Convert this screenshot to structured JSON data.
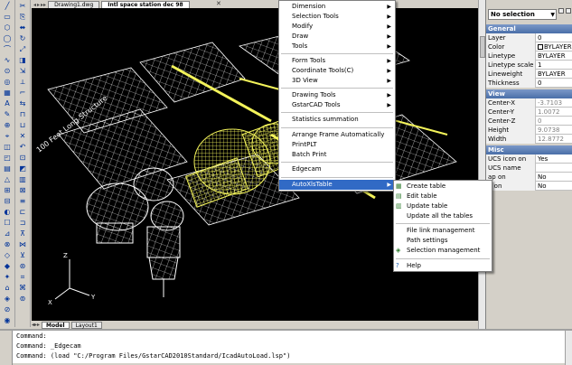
{
  "tabs": {
    "documents": [
      "Drawing1.dwg",
      "Intl space station dec 98"
    ],
    "active_index": 1,
    "layouts": [
      "Model",
      "Layout1"
    ],
    "active_layout": 0
  },
  "properties": {
    "selection": "No selection",
    "categories": {
      "general": "General",
      "view": "View",
      "misc": "Misc"
    },
    "general": [
      {
        "label": "Layer",
        "value": "0"
      },
      {
        "label": "Color",
        "value": "BYLAYER"
      },
      {
        "label": "Linetype",
        "value": "BYLAYER"
      },
      {
        "label": "Linetype scale",
        "value": "1"
      },
      {
        "label": "Lineweight",
        "value": "BYLAYER"
      },
      {
        "label": "Thickness",
        "value": "0"
      }
    ],
    "view": [
      {
        "label": "Center-X",
        "value": "-3.7103"
      },
      {
        "label": "Center-Y",
        "value": "1.0072"
      },
      {
        "label": "Center-Z",
        "value": "0"
      },
      {
        "label": "Height",
        "value": "9.0738"
      },
      {
        "label": "Width",
        "value": "12.8772"
      }
    ],
    "misc": [
      {
        "label": "UCS icon on",
        "value": "Yes"
      },
      {
        "label": "UCS name",
        "value": ""
      },
      {
        "label": "ap on",
        "value": "No"
      },
      {
        "label": "d on",
        "value": "No"
      }
    ]
  },
  "main_menu": {
    "items": [
      {
        "label": "Dimension",
        "submenu": true
      },
      {
        "label": "Selection Tools",
        "submenu": true
      },
      {
        "label": "Modify",
        "submenu": true
      },
      {
        "label": "Draw",
        "submenu": true
      },
      {
        "label": "Tools",
        "submenu": true
      },
      {
        "label": "Form Tools",
        "submenu": true
      },
      {
        "label": "Coordinate Tools(C)",
        "submenu": true
      },
      {
        "label": "3D View",
        "submenu": true
      },
      {
        "label": "Drawing Tools",
        "submenu": true
      },
      {
        "label": "GstarCAD Tools",
        "submenu": true
      },
      {
        "label": "Statistics summation",
        "submenu": false
      },
      {
        "label": "Arrange Frame Automatically",
        "submenu": false
      },
      {
        "label": "PrintPLT",
        "submenu": false
      },
      {
        "label": "Batch Print",
        "submenu": false
      },
      {
        "label": "Edgecam",
        "submenu": false
      },
      {
        "label": "AutoXlsTable",
        "submenu": true,
        "highlighted": true
      }
    ]
  },
  "sub_menu": {
    "items": [
      {
        "label": "Create table",
        "icon": "table-create-icon",
        "glyph": "▦"
      },
      {
        "label": "Edit table",
        "icon": "table-edit-icon",
        "glyph": "▤"
      },
      {
        "label": "Update table",
        "icon": "table-update-icon",
        "glyph": "▥"
      },
      {
        "label": "Update all the tables",
        "icon": "",
        "glyph": ""
      },
      {
        "label": "File link management",
        "icon": "",
        "glyph": ""
      },
      {
        "label": "Path settings",
        "icon": "",
        "glyph": ""
      },
      {
        "label": "Selection management",
        "icon": "selection-icon",
        "glyph": "◈"
      },
      {
        "label": "Help",
        "icon": "help-icon",
        "glyph": "?"
      }
    ]
  },
  "drawing": {
    "label": "100 Feet Long Structure",
    "colors": {
      "background": "#000000",
      "yellow": "#f3f35a",
      "white": "#ffffff"
    }
  },
  "command": {
    "lines": [
      "Command:",
      "Command: _Edgecam",
      "Command: (load \"C:/Program Files/GstarCAD2010Standard/IcadAutoLoad.lsp\")"
    ]
  },
  "colors": {
    "highlight": "#316ac5",
    "category": "#5a7fb8",
    "chrome": "#d4d0c8"
  }
}
